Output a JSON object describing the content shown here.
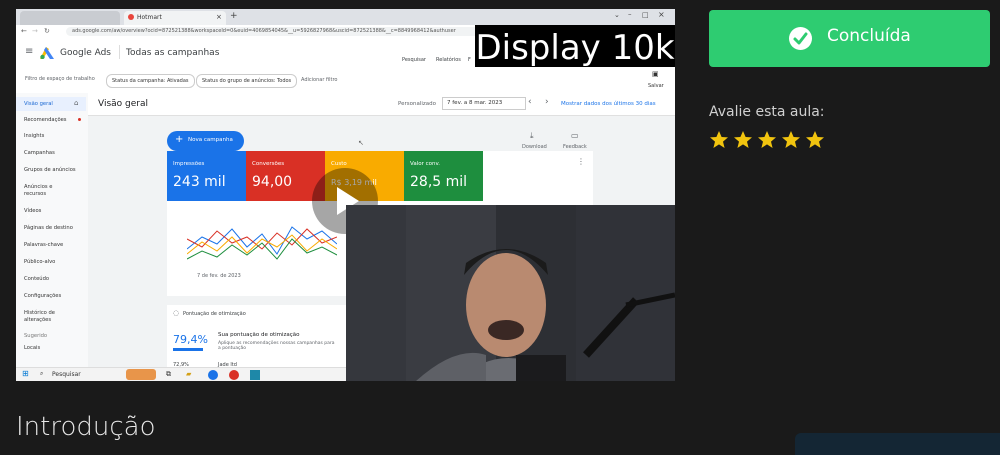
{
  "video": {
    "browser_tab": "Hotmart",
    "url": "ads.google.com/aw/overview?ocid=872521388&workspaceId=0&euid=4069854045&__u=5926827968&uscid=872521388&__c=8849968412&authuser",
    "app_name": "Google Ads",
    "header_title": "Todas as campanhas",
    "overlay_text": "Display 10k",
    "header_actions": [
      "Pesquisar",
      "Relatórios",
      "F"
    ],
    "filters": {
      "workspace": "Filtro de espaço de trabalho",
      "campaign_status": "Status da campanha: Ativadas",
      "adgroup_status": "Status do grupo de anúncios: Todos",
      "add_filter": "Adicionar filtro"
    },
    "save_label": "Salvar",
    "page_title": "Visão geral",
    "date_mode": "Personalizado",
    "date_range": "7 fev. a 8 mar. 2023",
    "date_link": "Mostrar dados dos últimos 30 dias",
    "sidebar": [
      "Visão geral",
      "Recomendações",
      "Insights",
      "Campanhas",
      "Grupos de anúncios",
      "Anúncios e recursos",
      "Vídeos",
      "Páginas de destino",
      "Palavras-chave",
      "Público-alvo",
      "Conteúdo",
      "Configurações",
      "Histórico de alterações",
      "Sugerido",
      "Locais"
    ],
    "new_campaign": "Nova campanha",
    "download": "Download",
    "feedback": "Feedback",
    "metrics": [
      {
        "label": "Impressões",
        "value": "243 mil",
        "color": "#1a73e8"
      },
      {
        "label": "Conversões",
        "value": "94,00",
        "color": "#d93025"
      },
      {
        "label": "Custo",
        "value": "R$ 3,19 mil",
        "color": "#f9ab00"
      },
      {
        "label": "Valor conv.",
        "value": "28,5 mil",
        "color": "#1e8e3e"
      }
    ],
    "chart_start_date": "7 de fev. de 2023",
    "optimization": {
      "title": "Pontuação de otimização",
      "score": "79,4%",
      "heading": "Sua pontuação de otimização",
      "desc": "Aplique as recomendações nossas campanhas para a pontuação",
      "score2": "72,9%",
      "label2": "Jade ltd"
    },
    "taskbar_search": "Pesquisar"
  },
  "complete_button": "Concluída",
  "rating": {
    "label": "Avalie esta aula:",
    "stars": 5,
    "star_color": "#f1c40f"
  },
  "lesson_title": "Introdução",
  "colors": {
    "accent": "#2ecc71",
    "background": "#1a1a1a"
  }
}
